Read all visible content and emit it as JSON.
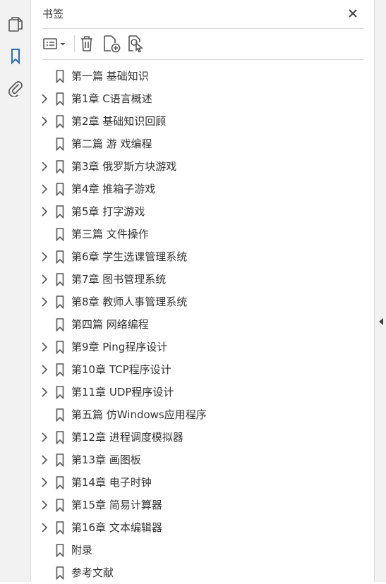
{
  "panel": {
    "title": "书签"
  },
  "colors": {
    "accent": "#2d6cb5",
    "icon_gray": "#555555",
    "divider": "#d8d8d8"
  },
  "rail": {
    "icons": [
      "pages-icon",
      "bookmarks-icon",
      "attachments-icon"
    ],
    "active": "bookmarks-icon"
  },
  "toolbar": {
    "icons": [
      "options-icon",
      "delete-icon",
      "add-bookmark-icon",
      "find-bookmark-icon"
    ]
  },
  "bookmarks": [
    {
      "label": "第一篇 基础知识",
      "expandable": false
    },
    {
      "label": "第1章 C语言概述",
      "expandable": true
    },
    {
      "label": "第2章 基础知识回顾",
      "expandable": true
    },
    {
      "label": "第二篇 游 戏编程",
      "expandable": false
    },
    {
      "label": "第3章 俄罗斯方块游戏",
      "expandable": true
    },
    {
      "label": "第4章 推箱子游戏",
      "expandable": true
    },
    {
      "label": "第5章 打字游戏",
      "expandable": true
    },
    {
      "label": "第三篇 文件操作",
      "expandable": false
    },
    {
      "label": "第6章 学生选课管理系统",
      "expandable": true
    },
    {
      "label": "第7章 图书管理系统",
      "expandable": true
    },
    {
      "label": "第8章 教师人事管理系统",
      "expandable": true
    },
    {
      "label": "第四篇 网络编程",
      "expandable": false
    },
    {
      "label": "第9章 Ping程序设计",
      "expandable": true
    },
    {
      "label": "第10章 TCP程序设计",
      "expandable": true
    },
    {
      "label": "第11章 UDP程序设计",
      "expandable": true
    },
    {
      "label": "第五篇 仿Windows应用程序",
      "expandable": false
    },
    {
      "label": "第12章 进程调度模拟器",
      "expandable": true
    },
    {
      "label": "第13章 画图板",
      "expandable": true
    },
    {
      "label": "第14章 电子时钟",
      "expandable": true
    },
    {
      "label": "第15章 简易计算器",
      "expandable": true
    },
    {
      "label": "第16章 文本编辑器",
      "expandable": true
    },
    {
      "label": "附录",
      "expandable": false
    },
    {
      "label": "参考文献",
      "expandable": false
    }
  ]
}
